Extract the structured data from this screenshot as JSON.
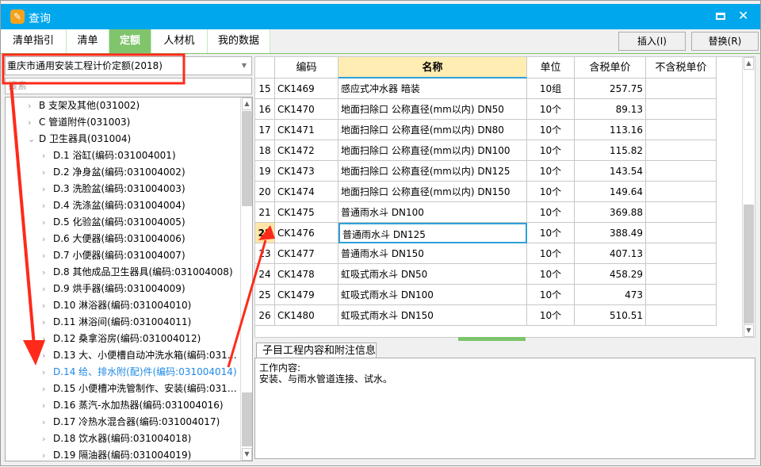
{
  "window": {
    "title": "查询",
    "maximize_icon": "maximize-icon",
    "close_icon": "close-icon"
  },
  "tabs": [
    {
      "label": "清单指引"
    },
    {
      "label": "清单"
    },
    {
      "label": "定额",
      "active": true
    },
    {
      "label": "人材机"
    },
    {
      "label": "我的数据"
    }
  ],
  "toolbar": {
    "insert_label": "插入(I)",
    "replace_label": "替换(R)"
  },
  "library_select": {
    "value": "重庆市通用安装工程计价定额(2018)"
  },
  "search": {
    "placeholder": "搜索"
  },
  "tree": [
    {
      "label": "B 支架及其他(031002)",
      "level": 1,
      "expanded": false
    },
    {
      "label": "C 管道附件(031003)",
      "level": 1,
      "expanded": false
    },
    {
      "label": "D 卫生器具(031004)",
      "level": 1,
      "expanded": true
    },
    {
      "label": "D.1 浴缸(编码:031004001)",
      "level": 2
    },
    {
      "label": "D.2 净身盆(编码:031004002)",
      "level": 2
    },
    {
      "label": "D.3 洗脸盆(编码:031004003)",
      "level": 2
    },
    {
      "label": "D.4 洗涤盆(编码:031004004)",
      "level": 2
    },
    {
      "label": "D.5 化验盆(编码:031004005)",
      "level": 2
    },
    {
      "label": "D.6 大便器(编码:031004006)",
      "level": 2
    },
    {
      "label": "D.7 小便器(编码:031004007)",
      "level": 2
    },
    {
      "label": "D.8 其他成品卫生器具(编码:031004008)",
      "level": 2
    },
    {
      "label": "D.9 烘手器(编码:031004009)",
      "level": 2
    },
    {
      "label": "D.10 淋浴器(编码:031004010)",
      "level": 2
    },
    {
      "label": "D.11 淋浴间(编码:031004011)",
      "level": 2
    },
    {
      "label": "D.12 桑拿浴房(编码:031004012)",
      "level": 2
    },
    {
      "label": "D.13 大、小便槽自动冲洗水箱(编码:031…",
      "level": 2
    },
    {
      "label": "D.14 给、排水附(配)件(编码:031004014)",
      "level": 2,
      "selected": true
    },
    {
      "label": "D.15 小便槽冲洗管制作、安装(编码:031…",
      "level": 2
    },
    {
      "label": "D.16 蒸汽-水加热器(编码:031004016)",
      "level": 2
    },
    {
      "label": "D.17 冷热水混合器(编码:031004017)",
      "level": 2
    },
    {
      "label": "D.18 饮水器(编码:031004018)",
      "level": 2
    },
    {
      "label": "D.19 隔油器(编码:031004019)",
      "level": 2
    }
  ],
  "grid": {
    "headers": [
      "",
      "编码",
      "名称",
      "单位",
      "含税单价",
      "不含税单价"
    ],
    "rows": [
      [
        "15",
        "CK1469",
        "感应式冲水器 暗装",
        "10组",
        "257.75",
        ""
      ],
      [
        "16",
        "CK1470",
        "地面扫除口 公称直径(mm以内) DN50",
        "10个",
        "89.13",
        ""
      ],
      [
        "17",
        "CK1471",
        "地面扫除口 公称直径(mm以内) DN80",
        "10个",
        "113.16",
        ""
      ],
      [
        "18",
        "CK1472",
        "地面扫除口 公称直径(mm以内) DN100",
        "10个",
        "115.82",
        ""
      ],
      [
        "19",
        "CK1473",
        "地面扫除口 公称直径(mm以内) DN125",
        "10个",
        "143.54",
        ""
      ],
      [
        "20",
        "CK1474",
        "地面扫除口 公称直径(mm以内) DN150",
        "10个",
        "149.64",
        ""
      ],
      [
        "21",
        "CK1475",
        "普通雨水斗 DN100",
        "10个",
        "369.88",
        ""
      ],
      [
        "22",
        "CK1476",
        "普通雨水斗 DN125",
        "10个",
        "388.49",
        ""
      ],
      [
        "23",
        "CK1477",
        "普通雨水斗 DN150",
        "10个",
        "407.13",
        ""
      ],
      [
        "24",
        "CK1478",
        "虹吸式雨水斗 DN50",
        "10个",
        "458.29",
        ""
      ],
      [
        "25",
        "CK1479",
        "虹吸式雨水斗 DN100",
        "10个",
        "473",
        ""
      ],
      [
        "26",
        "CK1480",
        "虹吸式雨水斗 DN150",
        "10个",
        "510.51",
        ""
      ]
    ],
    "selected_row": 7
  },
  "detail": {
    "tab_label": "子目工程内容和附注信息",
    "line1": "工作内容:",
    "line2": "安装、与雨水管道连接、试水。"
  },
  "colors": {
    "titlebar": "#00a7ec",
    "active_tab": "#80c46c",
    "selected_tree": "#1e8ae6",
    "header_highlight": "#ffedb3",
    "annotation": "#ff2a1a"
  }
}
